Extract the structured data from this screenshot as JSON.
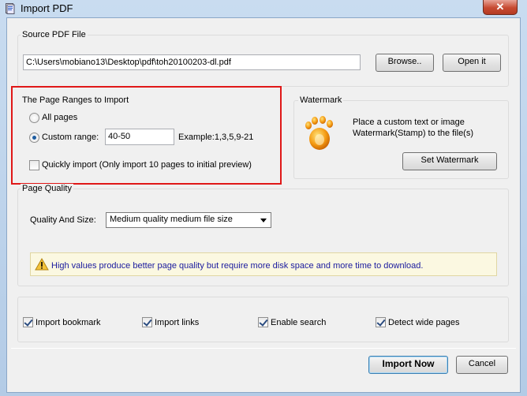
{
  "window": {
    "title": "Import PDF",
    "close_glyph": "✕"
  },
  "source": {
    "legend": "Source PDF File",
    "path": "C:\\Users\\mobiano13\\Desktop\\pdf\\toh20100203-dl.pdf",
    "browse_label": "Browse..",
    "open_label": "Open it"
  },
  "ranges": {
    "legend": "The Page Ranges to Import",
    "all_pages_label": "All pages",
    "custom_label": "Custom range:",
    "custom_value": "40-50",
    "example": "Example:1,3,5,9-21",
    "quick_label": "Quickly import (Only import 10 pages to  initial  preview)"
  },
  "watermark": {
    "legend": "Watermark",
    "desc_line1": "Place a custom text or image",
    "desc_line2": "Watermark(Stamp) to the file(s)",
    "button_label": "Set Watermark"
  },
  "quality": {
    "legend": "Page Quality",
    "label": "Quality And Size:",
    "selected": "Medium quality medium file size",
    "warning": "High values produce better page quality but require more disk space and more time to download."
  },
  "options": {
    "bookmark": "Import bookmark",
    "links": "Import links",
    "search": "Enable search",
    "wide": "Detect wide pages"
  },
  "footer": {
    "import_label": "Import Now",
    "cancel_label": "Cancel"
  },
  "colors": {
    "highlight": "#e01818",
    "warning_text": "#1a1a9e"
  }
}
